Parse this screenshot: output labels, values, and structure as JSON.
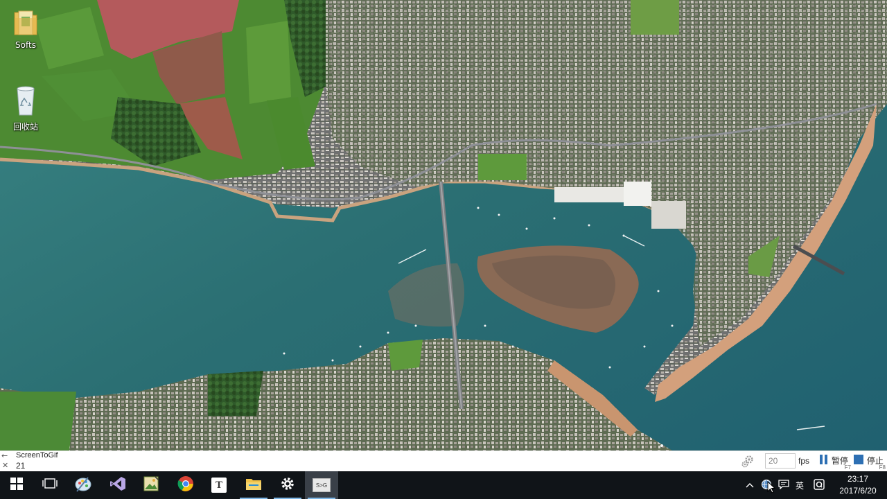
{
  "desktop": {
    "icons": [
      {
        "label": "Softs",
        "icon": "folder-archive-icon"
      },
      {
        "label": "回收站",
        "icon": "recycle-bin-icon"
      }
    ]
  },
  "recorder": {
    "app_name": "ScreenToGif",
    "frame_count": "21",
    "fps_value": "20",
    "fps_label": "fps",
    "pause_label": "暂停",
    "pause_key": "F7",
    "stop_label": "停止",
    "stop_key": "F8",
    "accent": "#2d6fb3"
  },
  "taskbar": {
    "apps": [
      {
        "name": "start",
        "icon": "windows-start-icon"
      },
      {
        "name": "task-view",
        "icon": "task-view-icon"
      },
      {
        "name": "paint",
        "icon": "paint-palette-icon"
      },
      {
        "name": "visual-studio",
        "icon": "visual-studio-icon"
      },
      {
        "name": "image-viewer",
        "icon": "image-editor-icon"
      },
      {
        "name": "chrome",
        "icon": "chrome-icon"
      },
      {
        "name": "typora",
        "icon": "typora-icon",
        "glyph": "T"
      },
      {
        "name": "file-explorer",
        "icon": "folder-icon"
      },
      {
        "name": "settings",
        "icon": "gear-icon"
      },
      {
        "name": "screentogif",
        "icon": "screen-recorder-icon",
        "glyph": "S>G"
      }
    ],
    "tray": {
      "ime_label": "英",
      "clock_time": "23:17",
      "clock_date": "2017/6/20"
    },
    "background": "#101418"
  }
}
